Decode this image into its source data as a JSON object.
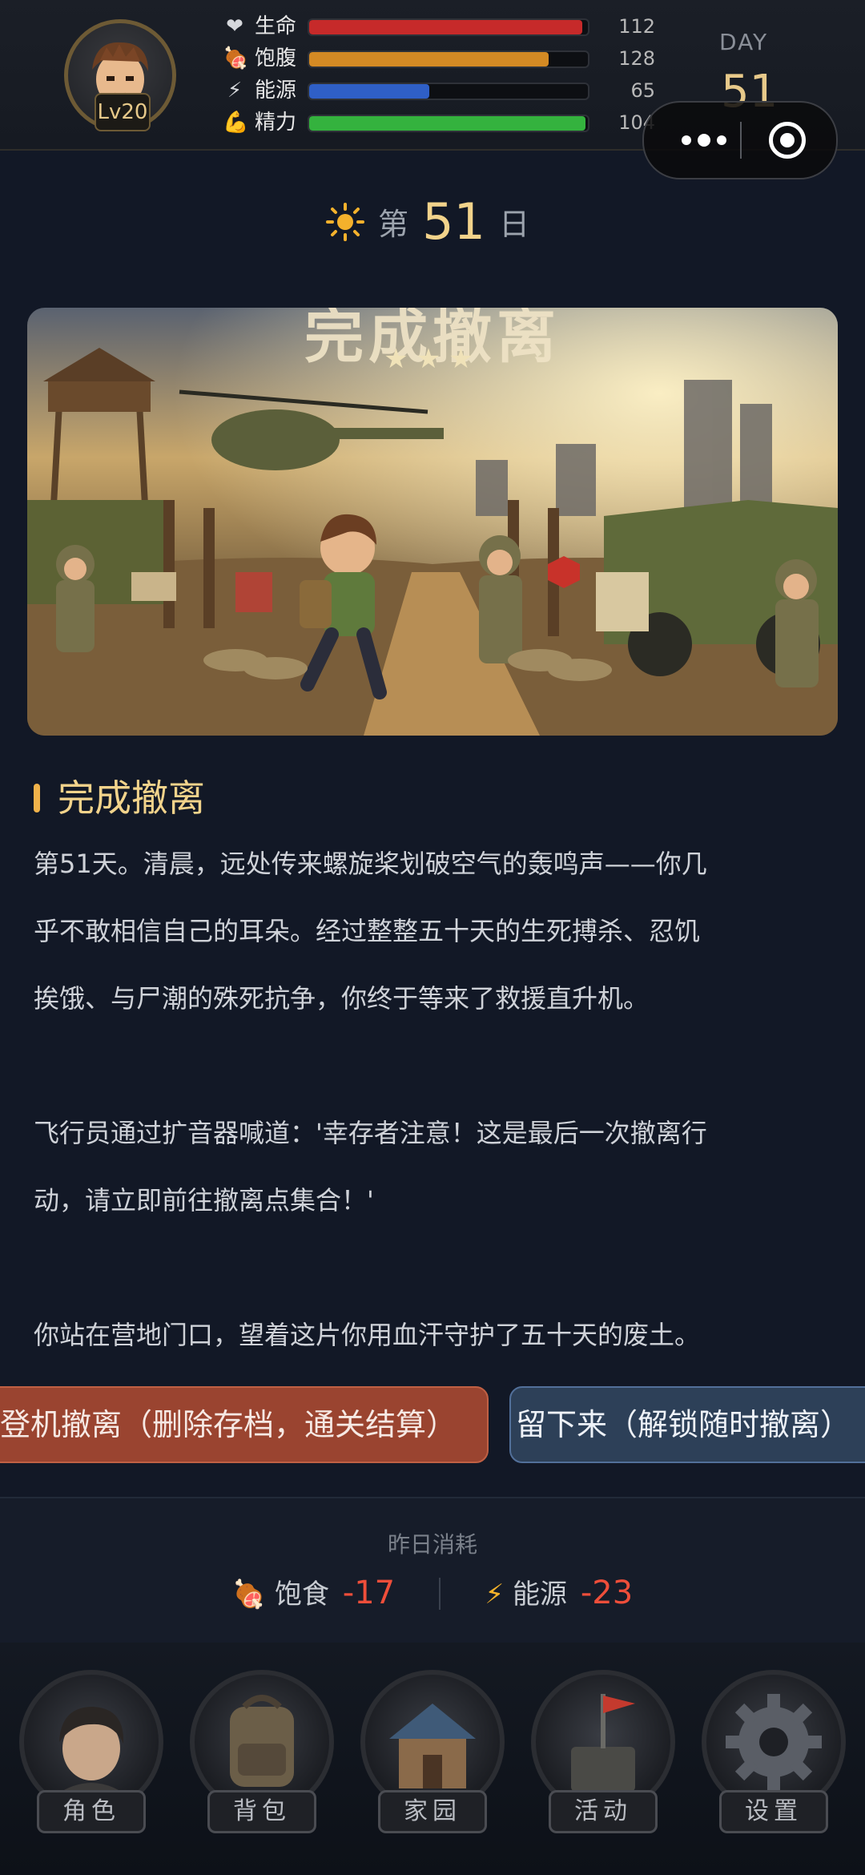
{
  "player": {
    "level": "Lv20"
  },
  "stats": [
    {
      "label": "生命",
      "value": 112,
      "fill_fraction": 0.98,
      "color": "#c62a2a",
      "icon": "heart-icon",
      "glyph": "❤"
    },
    {
      "label": "饱腹",
      "value": 128,
      "fill_fraction": 0.86,
      "color": "#d48a24",
      "icon": "meat-icon",
      "glyph": "🍖"
    },
    {
      "label": "能源",
      "value": 65,
      "fill_fraction": 0.43,
      "color": "#2f5fc6",
      "icon": "lightning-icon",
      "glyph": "⚡"
    },
    {
      "label": "精力",
      "value": 104,
      "fill_fraction": 0.99,
      "color": "#34b23e",
      "icon": "muscle-icon",
      "glyph": "💪"
    }
  ],
  "day": {
    "label": "DAY",
    "number": "51"
  },
  "day_heading": {
    "prefix": "第",
    "number": "51",
    "suffix": "日",
    "icon": "sun-icon"
  },
  "scene": {
    "title": "完成撤离",
    "stars": "★★★"
  },
  "event": {
    "title": "完成撤离",
    "paragraphs": [
      [
        "第51天。清晨，远处传来螺旋桨划破空气的轰鸣声——你几",
        "乎不敢相信自己的耳朵。经过整整五十天的生死搏杀、忍饥",
        "挨饿、与尸潮的殊死抗争，你终于等来了救援直升机。"
      ],
      [
        "飞行员通过扩音器喊道：'幸存者注意！这是最后一次撤离行",
        "动，请立即前往撤离点集合！'"
      ],
      [
        "你站在营地门口，望着这片你用血汗守护了五十天的废土。"
      ]
    ]
  },
  "choices": {
    "leave": "登机撤离（删除存档，通关结算）",
    "stay": "留下来（解锁随时撤离）"
  },
  "consumption": {
    "caption": "昨日消耗",
    "food_label": "饱食",
    "food_value": "-17",
    "energy_label": "能源",
    "energy_value": "-23"
  },
  "nav": [
    {
      "label": "角色",
      "icon": "character-icon"
    },
    {
      "label": "背包",
      "icon": "backpack-icon"
    },
    {
      "label": "家园",
      "icon": "house-icon"
    },
    {
      "label": "活动",
      "icon": "flag-chest-icon"
    },
    {
      "label": "设置",
      "icon": "gear-icon"
    }
  ],
  "colors": {
    "accent": "#f2d38b",
    "negative": "#ef4e3a",
    "leave_button": "#9a4430",
    "stay_button": "#2d4058"
  }
}
